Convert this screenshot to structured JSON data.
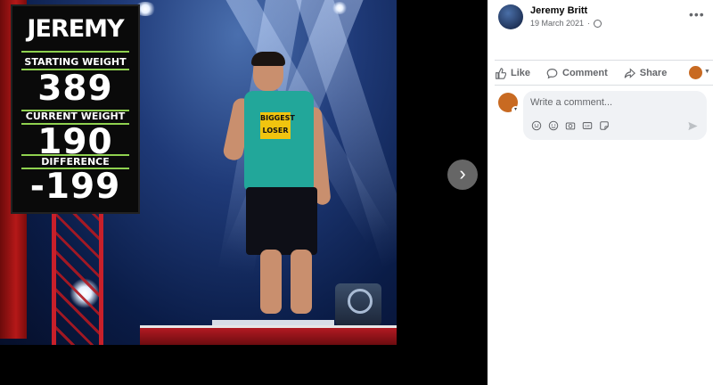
{
  "viewer": {
    "scoreboard": {
      "name": "JEREMY",
      "starting_label": "STARTING WEIGHT",
      "starting_value": "389",
      "current_label": "CURRENT WEIGHT",
      "current_value": "190",
      "difference_label": "DIFFERENCE",
      "difference_value": "-199"
    },
    "shirt_logo": "BIGGEST LOSER",
    "next_icon": "chevron-right-icon"
  },
  "post": {
    "author": "Jeremy Britt",
    "date": "19 March 2021",
    "separator": "·",
    "audience_icon": "globe-icon",
    "more_icon": "ellipsis-icon"
  },
  "actions": {
    "like": "Like",
    "comment": "Comment",
    "share": "Share"
  },
  "comment": {
    "placeholder": "Write a comment...",
    "icons": [
      "sticker-icon",
      "emoji-icon",
      "camera-icon",
      "gif-icon",
      "sticker-face-icon"
    ]
  },
  "colors": {
    "panel_bg": "#ffffff",
    "muted_text": "#65676b",
    "comment_bg": "#f0f2f5"
  }
}
